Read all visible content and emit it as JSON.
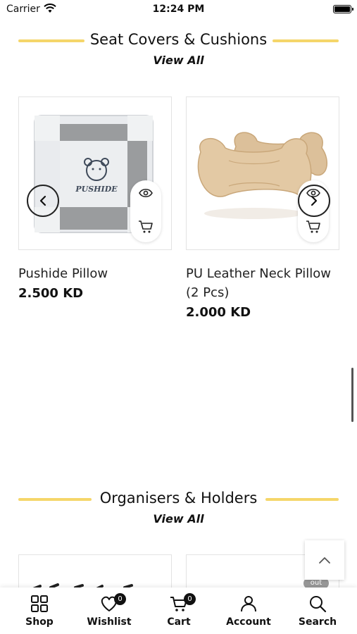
{
  "status_bar": {
    "carrier": "Carrier",
    "time": "12:24 PM"
  },
  "sections": [
    {
      "title": "Seat Covers & Cushions",
      "view_all": "View All"
    },
    {
      "title": "Organisers & Holders",
      "view_all": "View All"
    }
  ],
  "products": [
    {
      "name": "Pushide Pillow",
      "price": "2.500 KD",
      "logo_text": "PUSHIDE"
    },
    {
      "name": "PU Leather Neck Pillow (2 Pcs)",
      "price": "2.000 KD"
    }
  ],
  "out_badge": "out",
  "bottom_nav": {
    "items": [
      {
        "label": "Shop",
        "icon": "grid-icon"
      },
      {
        "label": "Wishlist",
        "icon": "heart-icon",
        "badge": "0"
      },
      {
        "label": "Cart",
        "icon": "cart-icon",
        "badge": "0"
      },
      {
        "label": "Account",
        "icon": "person-icon"
      },
      {
        "label": "Search",
        "icon": "search-icon"
      }
    ]
  },
  "colors": {
    "accent_line": "#f5d66a"
  }
}
